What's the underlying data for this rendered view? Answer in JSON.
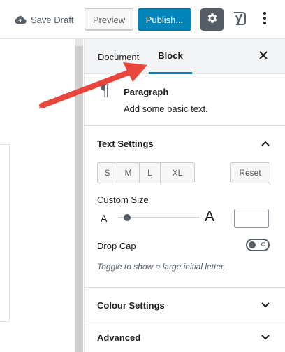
{
  "toolbar": {
    "save_draft_label": "Save Draft",
    "save_draft_icon": "cloud-upload-icon",
    "preview_label": "Preview",
    "publish_label": "Publish...",
    "settings_icon": "gear-icon",
    "yoast_icon": "yoast-icon",
    "more_icon": "more-vertical-icon"
  },
  "sidebar": {
    "tabs": [
      {
        "label": "Document",
        "active": false
      },
      {
        "label": "Block",
        "active": true
      }
    ],
    "close_icon": "close-icon",
    "block_card": {
      "icon": "paragraph-icon",
      "icon_glyph": "¶",
      "title": "Paragraph",
      "description": "Add some basic text."
    },
    "text_settings": {
      "title": "Text Settings",
      "expanded": true,
      "sizes": [
        "S",
        "M",
        "L",
        "XL"
      ],
      "reset_label": "Reset",
      "custom_size_label": "Custom Size",
      "range_small_label": "A",
      "range_large_label": "A",
      "custom_size_value": "",
      "drop_cap_label": "Drop Cap",
      "drop_cap_enabled": false,
      "drop_cap_help": "Toggle to show a large initial letter."
    },
    "colour_settings": {
      "title": "Colour Settings",
      "expanded": false
    },
    "advanced": {
      "title": "Advanced",
      "expanded": false
    }
  },
  "colors": {
    "accent": "#0085ba",
    "annotation_arrow": "#e8453c",
    "settings_button_bg": "#555d66"
  }
}
